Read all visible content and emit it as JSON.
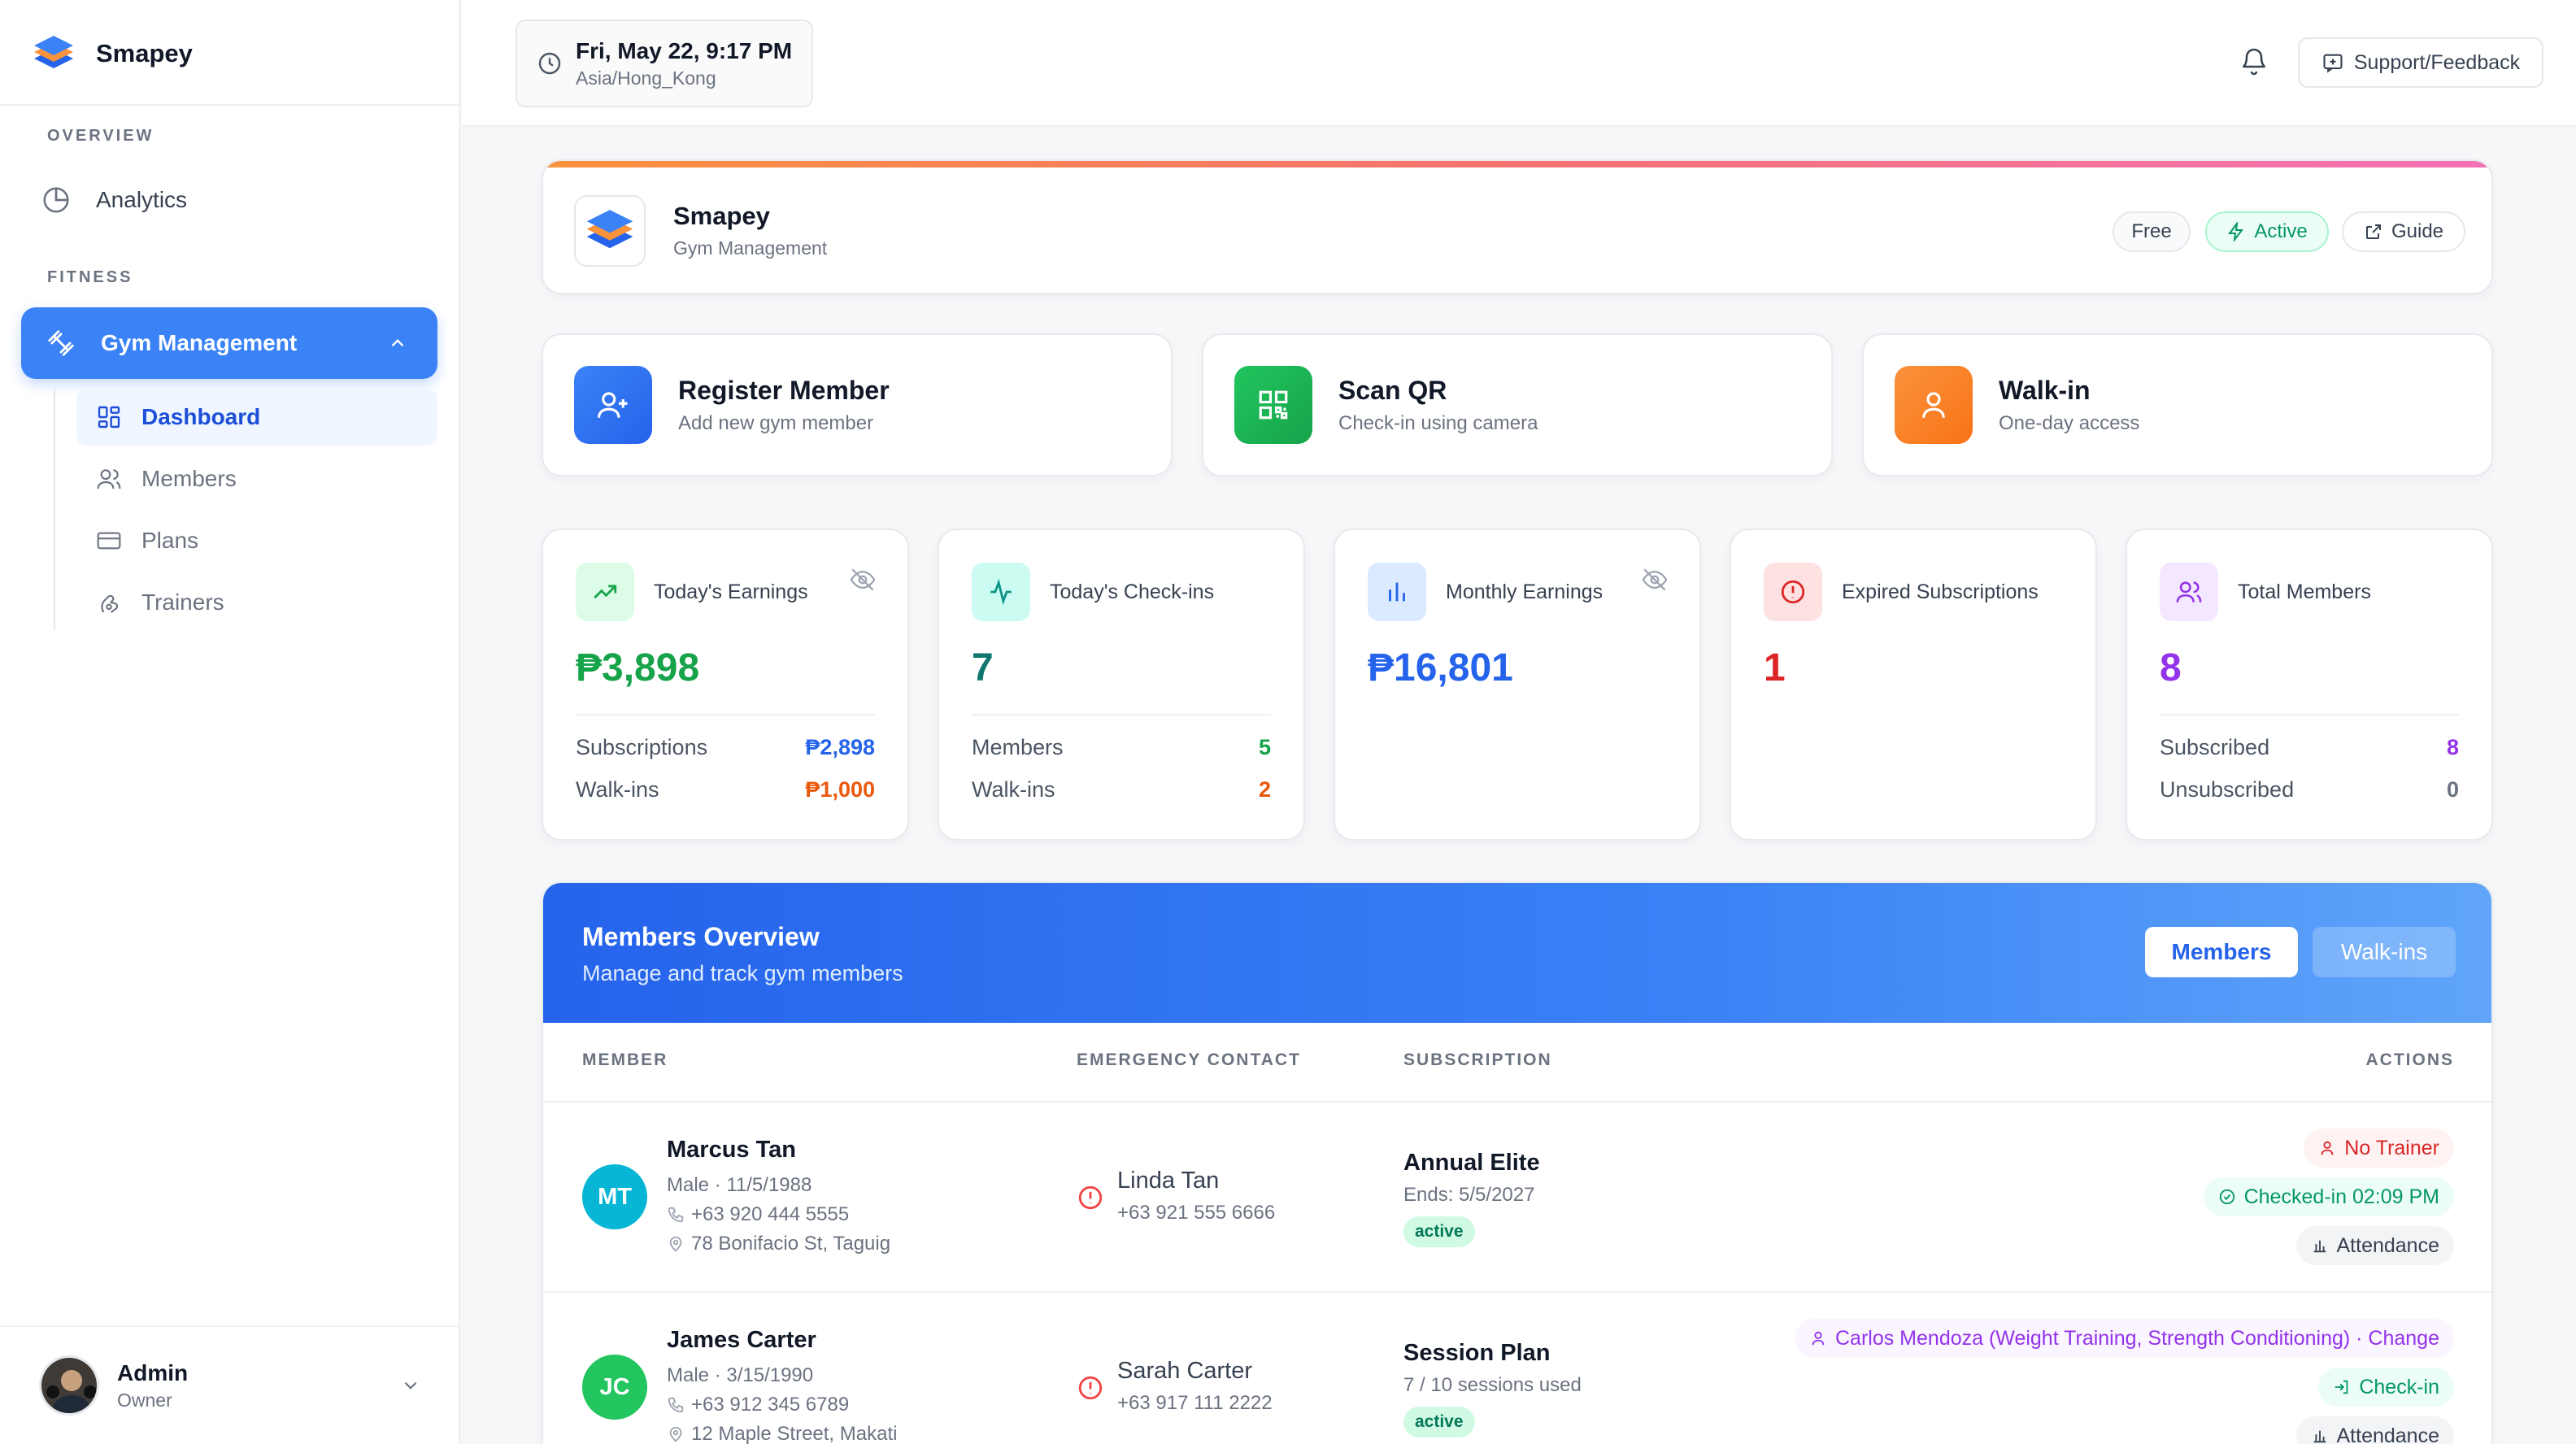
{
  "brand": {
    "name": "Smapey"
  },
  "sidebar": {
    "overview_label": "OVERVIEW",
    "analytics_label": "Analytics",
    "fitness_label": "FITNESS",
    "gym_label": "Gym Management",
    "subitems": [
      {
        "label": "Dashboard",
        "icon": "grid-icon"
      },
      {
        "label": "Members",
        "icon": "users-icon"
      },
      {
        "label": "Plans",
        "icon": "card-icon"
      },
      {
        "label": "Trainers",
        "icon": "trainer-icon"
      }
    ],
    "user": {
      "name": "Admin",
      "role": "Owner"
    }
  },
  "topbar": {
    "datetime": "Fri, May 22, 9:17 PM",
    "timezone": "Asia/Hong_Kong",
    "support_label": "Support/Feedback"
  },
  "app": {
    "title": "Smapey",
    "subtitle": "Gym Management",
    "badges": {
      "plan": "Free",
      "status": "Active",
      "guide": "Guide"
    }
  },
  "actions": [
    {
      "title": "Register Member",
      "subtitle": "Add new gym member",
      "color": "#3b82f6"
    },
    {
      "title": "Scan QR",
      "subtitle": "Check-in using camera",
      "color": "#22c55e"
    },
    {
      "title": "Walk-in",
      "subtitle": "One-day access",
      "color": "#f97316"
    }
  ],
  "stats": {
    "earnings": {
      "label": "Today's Earnings",
      "value": "₱3,898",
      "rows": [
        {
          "k": "Subscriptions",
          "v": "₱2,898"
        },
        {
          "k": "Walk-ins",
          "v": "₱1,000"
        }
      ]
    },
    "checkins": {
      "label": "Today's Check-ins",
      "value": "7",
      "rows": [
        {
          "k": "Members",
          "v": "5"
        },
        {
          "k": "Walk-ins",
          "v": "2"
        }
      ]
    },
    "monthly": {
      "label": "Monthly Earnings",
      "value": "₱16,801"
    },
    "expired": {
      "label": "Expired Subscriptions",
      "value": "1"
    },
    "total": {
      "label": "Total Members",
      "value": "8",
      "rows": [
        {
          "k": "Subscribed",
          "v": "8"
        },
        {
          "k": "Unsubscribed",
          "v": "0"
        }
      ]
    }
  },
  "members": {
    "title": "Members Overview",
    "subtitle": "Manage and track gym members",
    "tab_members": "Members",
    "tab_walkins": "Walk-ins",
    "columns": {
      "member": "MEMBER",
      "emergency": "EMERGENCY CONTACT",
      "subscription": "SUBSCRIPTION",
      "actions": "ACTIONS"
    },
    "rows": [
      {
        "initials": "MT",
        "avatar_color": "#06b6d4",
        "name": "Marcus Tan",
        "info": "Male  ·  11/5/1988",
        "phone": "+63 920 444 5555",
        "address": "78 Bonifacio St, Taguig",
        "ec_name": "Linda Tan",
        "ec_phone": "+63 921 555 6666",
        "plan": "Annual Elite",
        "plan_detail": "Ends: 5/5/2027",
        "status": "active",
        "trainer": "No Trainer",
        "checkin": "Checked-in 02:09 PM",
        "attendance": "Attendance"
      },
      {
        "initials": "JC",
        "avatar_color": "#22c55e",
        "name": "James Carter",
        "info": "Male  ·  3/15/1990",
        "phone": "+63 912 345 6789",
        "address": "12 Maple Street, Makati",
        "ec_name": "Sarah Carter",
        "ec_phone": "+63 917 111 2222",
        "plan": "Session Plan",
        "plan_detail": "7 / 10 sessions used",
        "status": "active",
        "trainer": "Carlos Mendoza (Weight Training, Strength Conditioning) · Change",
        "checkin": "Check-in",
        "attendance": "Attendance"
      }
    ]
  }
}
